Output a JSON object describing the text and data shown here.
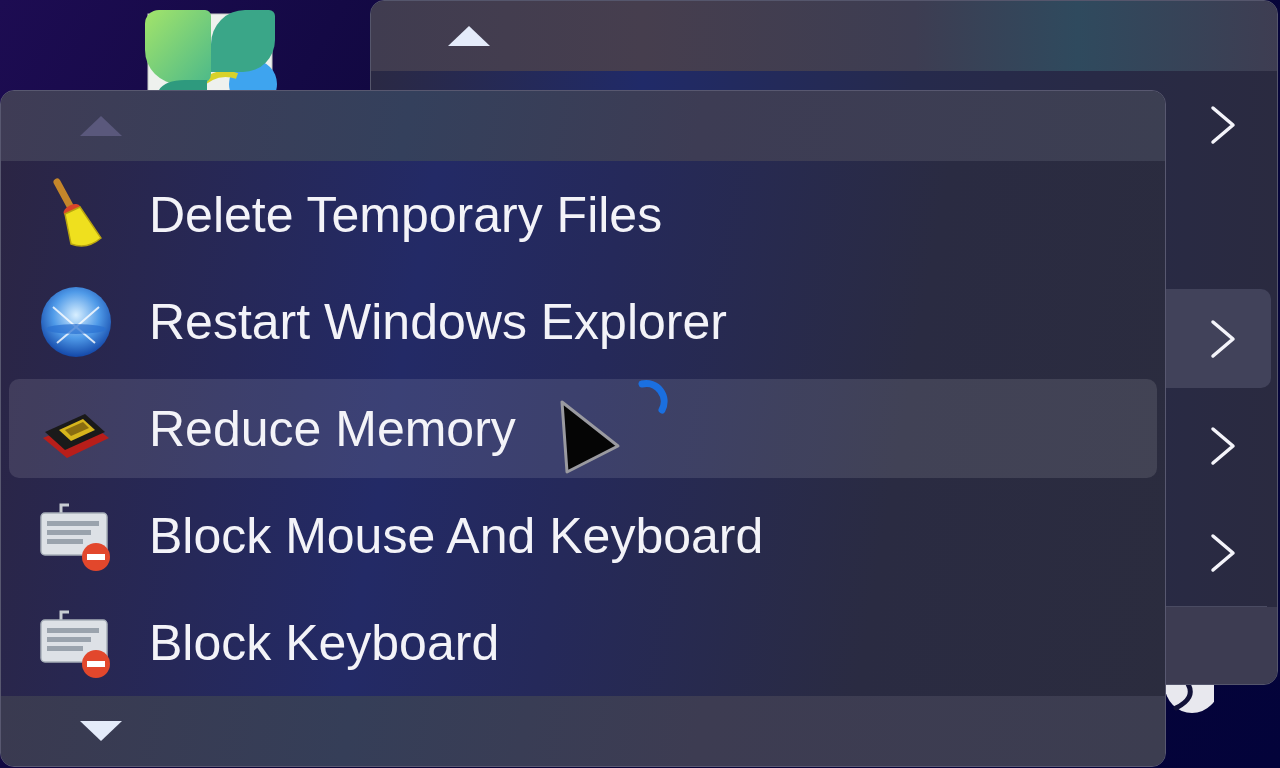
{
  "back_menu": {
    "scroll_up": {
      "disabled": false
    },
    "items": [
      {
        "submenu": true,
        "selected": false
      },
      {
        "submenu": false,
        "selected": false
      },
      {
        "submenu": true,
        "selected": true
      },
      {
        "submenu": true,
        "selected": false
      },
      {
        "submenu": true,
        "selected": false
      }
    ]
  },
  "front_menu": {
    "scroll_up": {
      "disabled": true
    },
    "items": [
      {
        "kind": "broom",
        "label": "Delete Temporary Files",
        "selected": false
      },
      {
        "kind": "globe",
        "label": "Restart Windows Explorer",
        "selected": false
      },
      {
        "kind": "chip",
        "label": "Reduce Memory",
        "selected": true
      },
      {
        "kind": "keyboard",
        "label": "Block Mouse And Keyboard",
        "selected": false
      },
      {
        "kind": "keyboard",
        "label": "Block Keyboard",
        "selected": false
      }
    ],
    "scroll_down": {
      "disabled": false
    }
  }
}
